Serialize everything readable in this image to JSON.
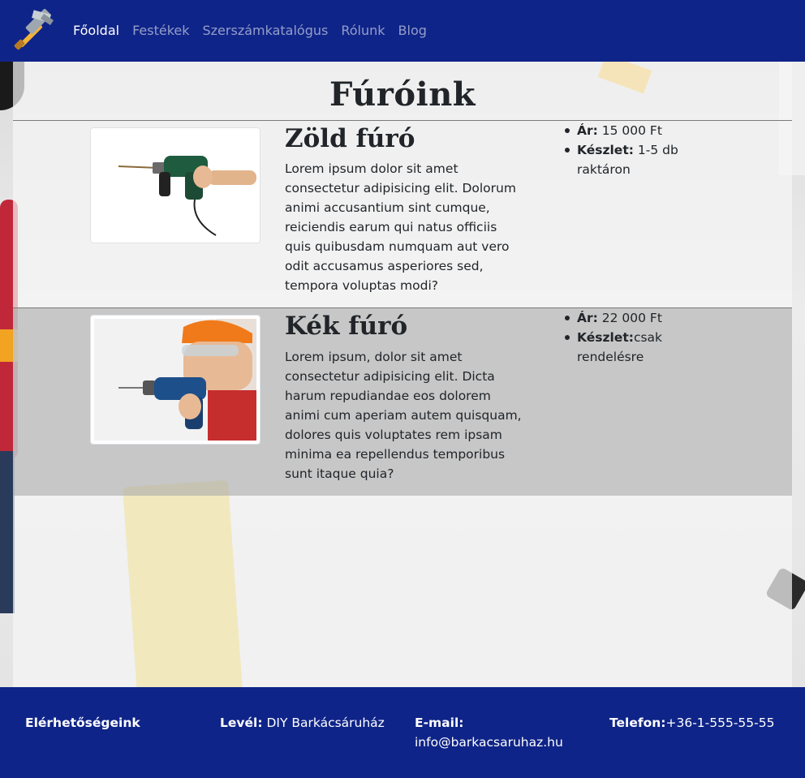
{
  "nav": {
    "items": [
      {
        "label": "Főoldal",
        "active": true
      },
      {
        "label": "Festékek",
        "active": false
      },
      {
        "label": "Szerszámkatalógus",
        "active": false
      },
      {
        "label": "Rólunk",
        "active": false
      },
      {
        "label": "Blog",
        "active": false
      }
    ],
    "logo_icon": "hammer-icon"
  },
  "page": {
    "title": "Fúróink"
  },
  "products": [
    {
      "title": "Zöld fúró",
      "description": "Lorem ipsum dolor sit amet consectetur adipisicing elit. Dolorum animi accusantium sint cumque, reiciendis earum qui natus officiis quis quibusdam numquam aut vero odit accusamus asperiores sed, tempora voluptas modi?",
      "price_label": "Ár:",
      "price_value": " 15 000 Ft",
      "stock_label": "Készlet:",
      "stock_value": " 1-5 db raktáron",
      "image": "green-drill-photo"
    },
    {
      "title": "Kék fúró",
      "description": "Lorem ipsum, dolor sit amet consectetur adipisicing elit. Dicta harum repudiandae eos dolorem animi cum aperiam autem quisquam, dolores quis voluptates rem ipsam minima ea repellendus temporibus sunt itaque quia?",
      "price_label": "Ár:",
      "price_value": " 22 000 Ft",
      "stock_label": "Készlet:",
      "stock_value": "csak rendelésre",
      "image": "blue-drill-photo"
    }
  ],
  "footer": {
    "heading": "Elérhetőségeink",
    "mail_label": "Levél:",
    "mail_value": " DIY Barkácsáruház",
    "email_label": "E-mail:",
    "email_value": "info@barkacsaruhaz.hu",
    "phone_label": "Telefon:",
    "phone_value": "+36-1-555-55-55"
  },
  "colors": {
    "brand": "#0f2488",
    "nav_active": "#ffffff",
    "nav_inactive": "#a3aad0"
  }
}
